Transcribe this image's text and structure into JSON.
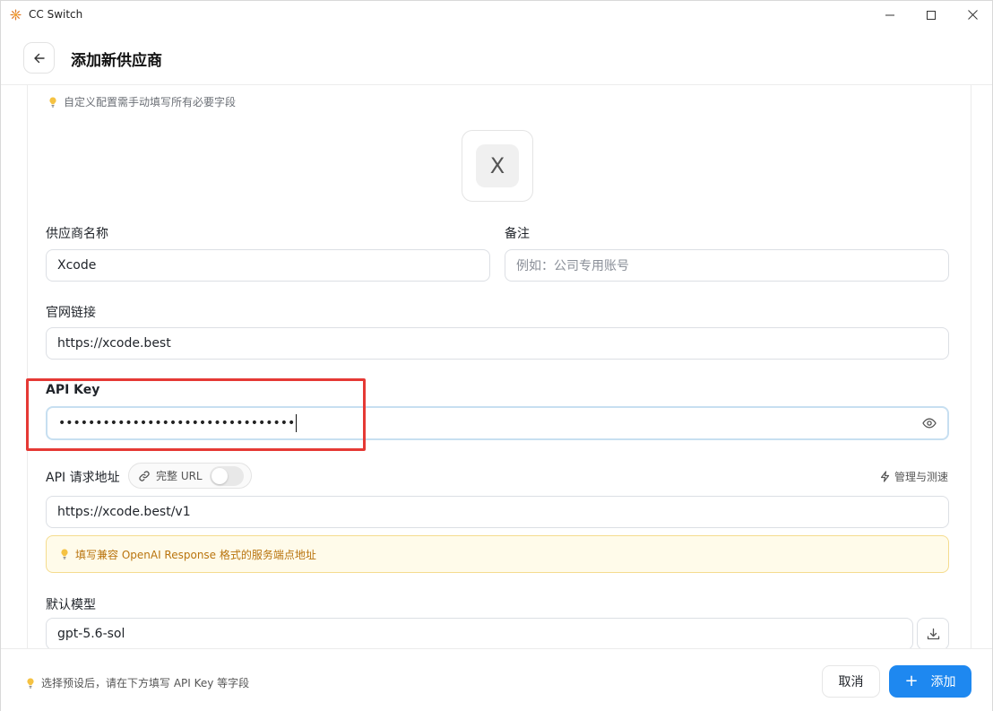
{
  "window": {
    "title": "CC Switch"
  },
  "header": {
    "title": "添加新供应商"
  },
  "form": {
    "custom_hint": "自定义配置需手动填写所有必要字段",
    "logo_letter": "X",
    "provider_name": {
      "label": "供应商名称",
      "value": "Xcode"
    },
    "notes": {
      "label": "备注",
      "placeholder": "例如：公司专用账号"
    },
    "website": {
      "label": "官网链接",
      "value": "https://xcode.best"
    },
    "api_key": {
      "label": "API Key",
      "value": "••••••••••••••••••••••••••••••••"
    },
    "api_url": {
      "label": "API 请求地址",
      "full_url_label": "完整 URL",
      "full_url_enabled": false,
      "manage_label": "管理与测速",
      "value": "https://xcode.best/v1"
    },
    "endpoint_hint": "填写兼容 OpenAI Response 格式的服务端点地址",
    "default_model": {
      "label": "默认模型",
      "value": "gpt-5.6-sol"
    }
  },
  "footer": {
    "hint": "选择预设后，请在下方填写 API Key 等字段",
    "cancel_label": "取消",
    "add_label": "添加"
  },
  "colors": {
    "accent": "#1e88f0",
    "highlight": "#e53935",
    "warning_text": "#b9740e",
    "warning_bg": "#fffbea"
  }
}
